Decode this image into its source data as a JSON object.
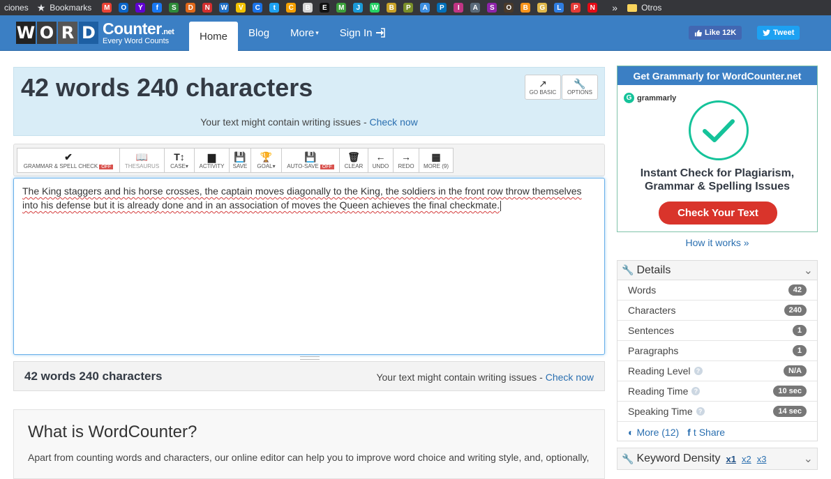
{
  "bookmarks_bar": {
    "leading_text": "ciones",
    "bookmarks_label": "Bookmarks",
    "favicons": [
      {
        "name": "gmail",
        "color": "#ea4335",
        "glyph": "M"
      },
      {
        "name": "outlook",
        "color": "#0a64c8",
        "glyph": "O"
      },
      {
        "name": "yahoo",
        "color": "#6001d2",
        "glyph": "Y"
      },
      {
        "name": "facebook",
        "color": "#1877f2",
        "glyph": "f"
      },
      {
        "name": "site-s",
        "color": "#2e8b3a",
        "glyph": "S"
      },
      {
        "name": "site-orange",
        "color": "#e0681a",
        "glyph": "D"
      },
      {
        "name": "site-red",
        "color": "#d32f2f",
        "glyph": "N"
      },
      {
        "name": "site-blue",
        "color": "#1e6fc6",
        "glyph": "W"
      },
      {
        "name": "flag",
        "color": "#f2c200",
        "glyph": "V"
      },
      {
        "name": "shield",
        "color": "#1a73e8",
        "glyph": "C"
      },
      {
        "name": "twitter",
        "color": "#1da1f2",
        "glyph": "t"
      },
      {
        "name": "site-yellow",
        "color": "#f5a000",
        "glyph": "C"
      },
      {
        "name": "doc",
        "color": "#d6d6d6",
        "glyph": "B"
      },
      {
        "name": "black",
        "color": "#111111",
        "glyph": "E"
      },
      {
        "name": "movistar",
        "color": "#3ca03c",
        "glyph": "M"
      },
      {
        "name": "site-cyan",
        "color": "#1a99d6",
        "glyph": "J"
      },
      {
        "name": "whatsapp",
        "color": "#25d366",
        "glyph": "W"
      },
      {
        "name": "site-gold",
        "color": "#c9a227",
        "glyph": "B"
      },
      {
        "name": "site-olive",
        "color": "#7a8f2a",
        "glyph": "P"
      },
      {
        "name": "site-sky",
        "color": "#3c8ee0",
        "glyph": "A"
      },
      {
        "name": "paypal",
        "color": "#0070ba",
        "glyph": "P"
      },
      {
        "name": "instagram",
        "color": "#c13584",
        "glyph": "I"
      },
      {
        "name": "site-steel",
        "color": "#5a6a7a",
        "glyph": "A"
      },
      {
        "name": "site-purple",
        "color": "#8e24aa",
        "glyph": "S"
      },
      {
        "name": "site-dark",
        "color": "#4a3a2a",
        "glyph": "O"
      },
      {
        "name": "bitcoin",
        "color": "#f7931a",
        "glyph": "B"
      },
      {
        "name": "site-tan",
        "color": "#e0b84a",
        "glyph": "G"
      },
      {
        "name": "bars",
        "color": "#2f7de1",
        "glyph": "L"
      },
      {
        "name": "site-red2",
        "color": "#e53935",
        "glyph": "P"
      },
      {
        "name": "netflix",
        "color": "#e50914",
        "glyph": "N"
      }
    ],
    "overflow": "»",
    "other_label": "Otros"
  },
  "navbar": {
    "logo_letters": [
      "W",
      "O",
      "R",
      "D"
    ],
    "logo_colors": [
      "#222222",
      "#3a3a3a",
      "#555555",
      "#1d5fa3"
    ],
    "logo_brand": "Counter",
    "logo_suffix": ".net",
    "logo_tagline": "Every Word Counts",
    "items": [
      {
        "label": "Home",
        "active": true
      },
      {
        "label": "Blog"
      },
      {
        "label": "More",
        "caret": "▾"
      },
      {
        "label": "Sign In",
        "icon": "sign-in-icon"
      }
    ],
    "like_label": "Like 12K",
    "tweet_label": "Tweet"
  },
  "summary": {
    "headline": "42 words 240 characters",
    "issues_text": "Your text might contain writing issues - ",
    "check_now": "Check now",
    "go_basic": "GO BASIC",
    "options": "OPTIONS"
  },
  "toolbar": {
    "buttons": [
      {
        "label": "GRAMMAR & SPELL CHECK",
        "badge": "OFF",
        "icon": "✔"
      },
      {
        "label": "THESAURUS",
        "icon": "📖",
        "disabled": true
      },
      {
        "label": "CASE",
        "icon": "T↕",
        "caret": "▾"
      },
      {
        "label": "ACTIVITY",
        "icon": "▆"
      },
      {
        "label": "SAVE",
        "icon": "💾"
      },
      {
        "label": "GOAL",
        "icon": "🏆",
        "caret": "▾"
      },
      {
        "label": "AUTO-SAVE",
        "badge": "OFF",
        "icon": "💾"
      },
      {
        "label": "CLEAR",
        "icon": "🗑"
      },
      {
        "label": "UNDO",
        "icon": "←"
      },
      {
        "label": "REDO",
        "icon": "→"
      },
      {
        "label": "MORE (9)",
        "icon": "▦"
      }
    ]
  },
  "editor": {
    "text": "The King staggers and his horse crosses, the captain moves diagonally to the King, the soldiers in the front row throw themselves into his defense but it is already done and in an association of moves the Queen achieves the final checkmate."
  },
  "footer_bar": {
    "count": "42 words 240 characters",
    "issues_text": "Your text might contain writing issues - ",
    "check_now": "Check now"
  },
  "what_section": {
    "title": "What is WordCounter?",
    "body": "Apart from counting words and characters, our online editor can help you to improve word choice and writing style, and, optionally,"
  },
  "ad": {
    "header": "Get Grammarly for WordCounter.net",
    "brand": "grammarly",
    "title_line1": "Instant Check for Plagiarism,",
    "title_line2": "Grammar & Spelling Issues",
    "cta": "Check Your Text",
    "colors": {
      "brand": "#15c39a",
      "cta": "#d9342b"
    }
  },
  "how_it_works": "How it works »",
  "details": {
    "title": "Details",
    "rows": [
      {
        "label": "Words",
        "value": "42",
        "help": false
      },
      {
        "label": "Characters",
        "value": "240",
        "help": false
      },
      {
        "label": "Sentences",
        "value": "1",
        "help": false
      },
      {
        "label": "Paragraphs",
        "value": "1",
        "help": false
      },
      {
        "label": "Reading Level",
        "value": "N/A",
        "help": true
      },
      {
        "label": "Reading Time",
        "value": "10 sec",
        "help": true
      },
      {
        "label": "Speaking Time",
        "value": "14 sec",
        "help": true
      }
    ],
    "more_label": "More (12)",
    "share_label": "Share"
  },
  "keyword_density": {
    "title": "Keyword Density",
    "options": [
      "x1",
      "x2",
      "x3"
    ]
  }
}
